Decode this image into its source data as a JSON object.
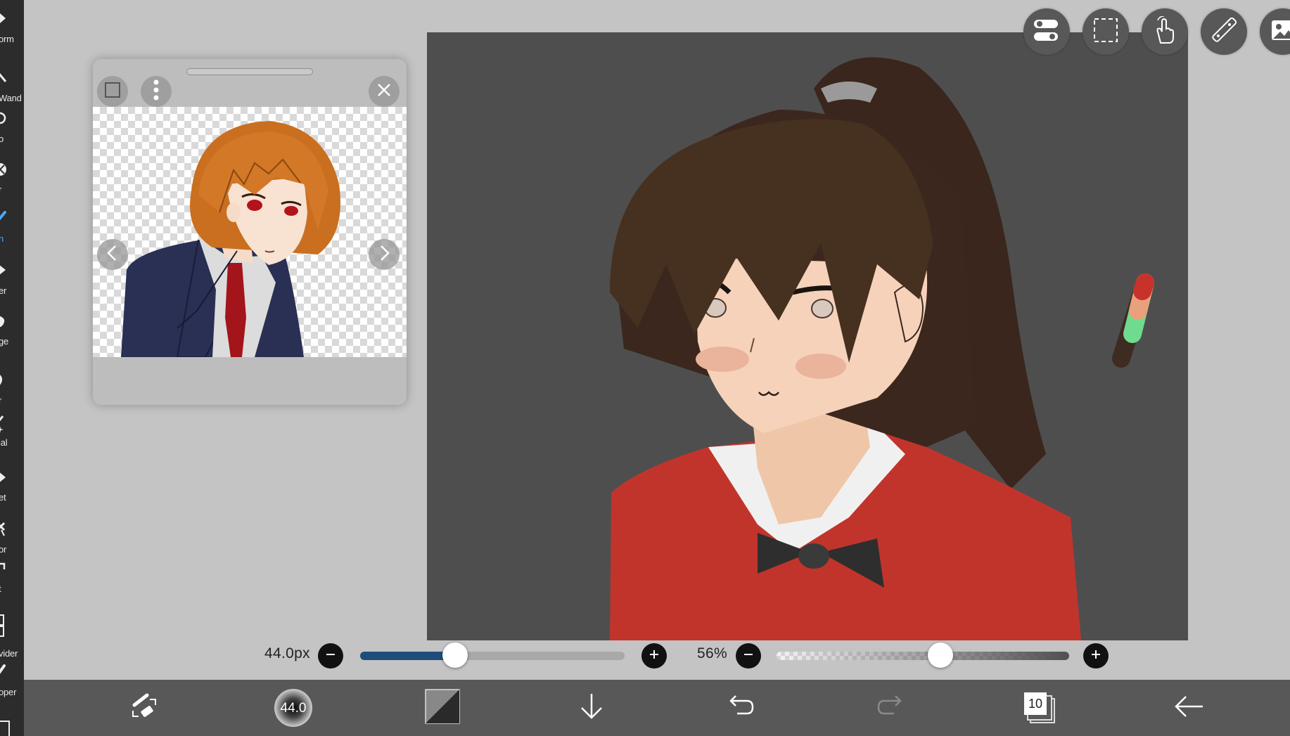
{
  "left_toolbar": {
    "tools": [
      {
        "label": "orm",
        "icon": "transform-icon"
      },
      {
        "label": "Wand",
        "icon": "magic-wand-icon"
      },
      {
        "label": "o",
        "icon": "lasso-icon"
      },
      {
        "label": "r",
        "icon": "filter-icon"
      },
      {
        "label": "h",
        "icon": "brush-icon",
        "active": true
      },
      {
        "label": "er",
        "icon": "eraser-icon"
      },
      {
        "label": "ge",
        "icon": "smudge-icon"
      },
      {
        "label": "r",
        "icon": "blur-icon"
      },
      {
        "label": "ial",
        "icon": "special-brush-icon"
      },
      {
        "label": "et",
        "icon": "bucket-icon"
      },
      {
        "label": "or",
        "icon": "gradient-icon"
      },
      {
        "label": "t",
        "icon": "text-icon"
      },
      {
        "label": "vider",
        "icon": "frame-divider-icon"
      },
      {
        "label": "oper",
        "icon": "eyedropper-icon"
      }
    ]
  },
  "reference_window": {
    "buttons": [
      "expand-icon",
      "more-options-icon",
      "close-icon",
      "previous-arrow-icon",
      "next-arrow-icon"
    ]
  },
  "top_right_buttons": [
    "toggle-icon",
    "selection-icon",
    "touch-icon",
    "ruler-icon",
    "gallery-icon"
  ],
  "brush_size": {
    "value_label": "44.0px",
    "fraction": 0.36
  },
  "opacity": {
    "value_label": "56%",
    "fraction": 0.56
  },
  "colors": {
    "size_track": "#1f4d79",
    "history": [
      "#c8322a",
      "#e9a07c",
      "#6fdb8e",
      "#3e2b22"
    ]
  },
  "bottom_toolbar": {
    "brush_preview_label": "44.0",
    "layers_count": "10",
    "buttons": [
      "swap-tool-icon",
      "brush-preview-icon",
      "color-swatch-icon",
      "download-icon",
      "undo-icon",
      "redo-icon",
      "layers-icon",
      "back-arrow-icon"
    ]
  }
}
